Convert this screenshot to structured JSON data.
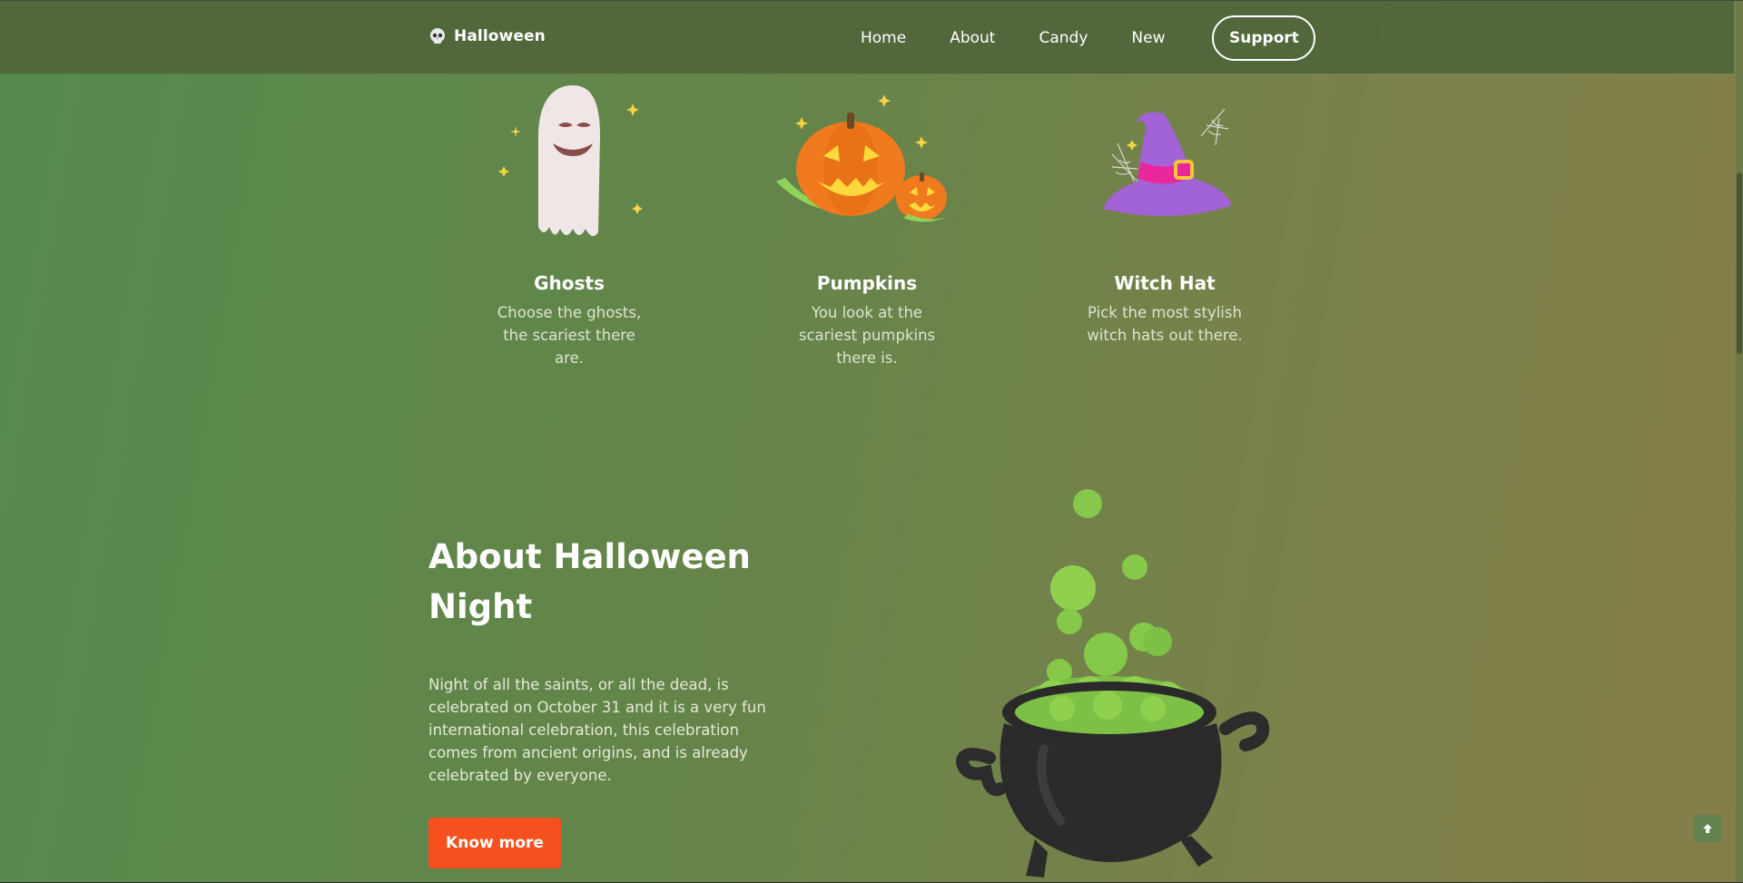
{
  "header": {
    "brand": "Halloween",
    "brand_icon": "skull-icon",
    "nav": [
      "Home",
      "About",
      "Candy",
      "New"
    ],
    "support_label": "Support"
  },
  "cards": [
    {
      "title": "Ghosts",
      "desc": "Choose the ghosts, the scariest there are.",
      "icon": "ghost-icon"
    },
    {
      "title": "Pumpkins",
      "desc": "You look at the scariest pumpkins there is.",
      "icon": "pumpkin-icon"
    },
    {
      "title": "Witch Hat",
      "desc": "Pick the most stylish witch hats out there.",
      "icon": "witch-hat-icon"
    }
  ],
  "about": {
    "title": "About Halloween Night",
    "text": "Night of all the saints, or all the dead, is celebrated on October 31 and it is a very fun international celebration, this celebration comes from ancient origins, and is already celebrated by everyone.",
    "button_label": "Know more",
    "image_icon": "cauldron-icon"
  },
  "scroll_top_icon": "arrow-up-icon",
  "colors": {
    "accent": "#f4511e",
    "background_left": "#558a4c",
    "background_right": "#857e48",
    "text": "#ffffff"
  }
}
